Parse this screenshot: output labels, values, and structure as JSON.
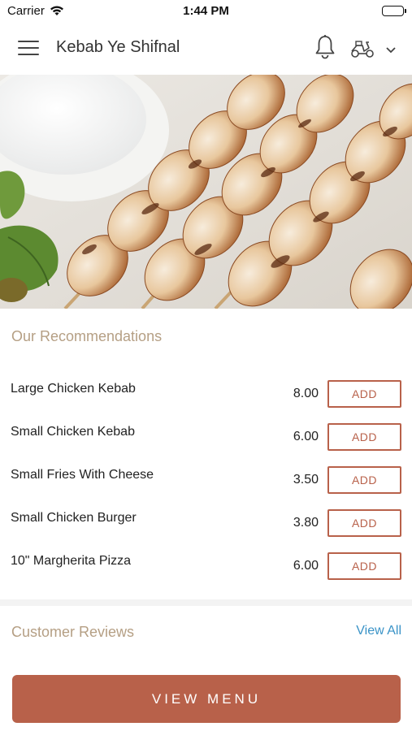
{
  "status_bar": {
    "carrier": "Carrier",
    "time": "1:44 PM",
    "icons": [
      "wifi-icon",
      "battery-icon"
    ]
  },
  "header": {
    "title": "Kebab Ye Shifnal",
    "icons": [
      "menu-icon",
      "bell-icon",
      "scooter-icon",
      "chevron-down-icon"
    ]
  },
  "hero": {
    "description_icon": "food-photo"
  },
  "recommendations": {
    "title": "Our Recommendations",
    "add_label": "ADD",
    "items": [
      {
        "name": "Large Chicken Kebab",
        "price": "8.00"
      },
      {
        "name": "Small Chicken Kebab",
        "price": "6.00"
      },
      {
        "name": "Small Fries With Cheese",
        "price": "3.50"
      },
      {
        "name": "Small Chicken Burger",
        "price": "3.80"
      },
      {
        "name": "10\" Margherita Pizza",
        "price": "6.00"
      }
    ]
  },
  "reviews": {
    "title": "Customer Reviews",
    "view_all": "View All"
  },
  "cta": {
    "label": "VIEW MENU"
  },
  "colors": {
    "accent": "#b8614a",
    "section_title": "#b59f84",
    "link": "#3a93c7"
  }
}
